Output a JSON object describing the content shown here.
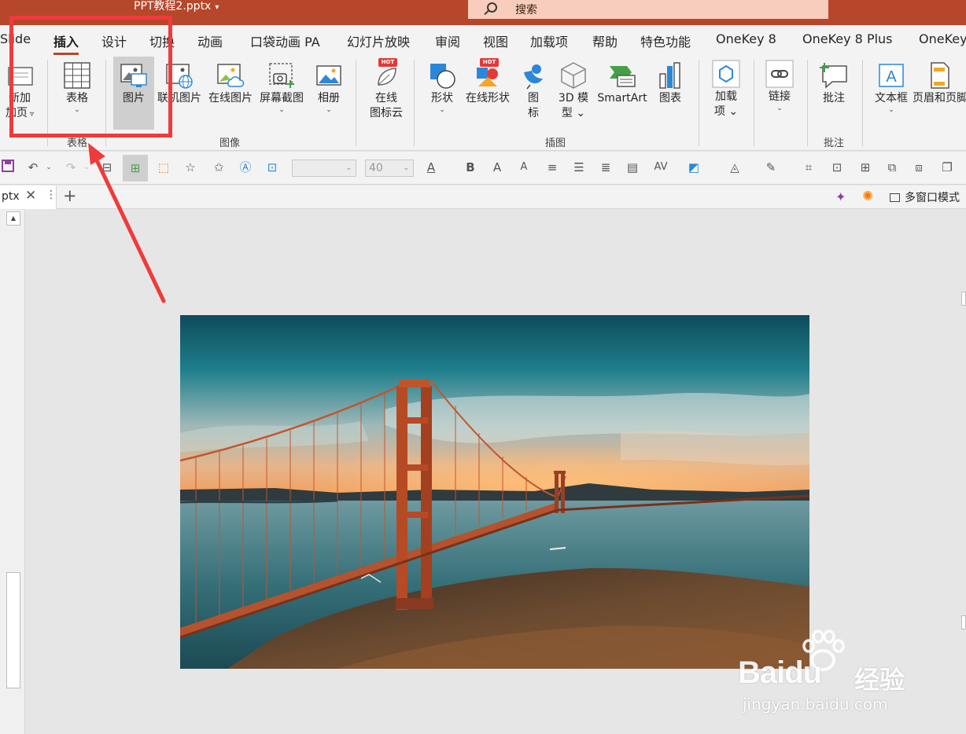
{
  "titlebar": {
    "doc_title": "PPT教程2.pptx",
    "caret": "▾",
    "search_placeholder": "搜索"
  },
  "tabs": [
    {
      "label": "Slide",
      "active": false
    },
    {
      "label": "插入",
      "active": true
    },
    {
      "label": "设计",
      "active": false
    },
    {
      "label": "切换",
      "active": false
    },
    {
      "label": "动画",
      "active": false
    },
    {
      "label": "口袋动画 PA",
      "active": false
    },
    {
      "label": "幻灯片放映",
      "active": false
    },
    {
      "label": "审阅",
      "active": false
    },
    {
      "label": "视图",
      "active": false
    },
    {
      "label": "加载项",
      "active": false
    },
    {
      "label": "帮助",
      "active": false
    },
    {
      "label": "特色功能",
      "active": false
    },
    {
      "label": "OneKey 8",
      "active": false
    },
    {
      "label": "OneKey 8 Plus",
      "active": false
    },
    {
      "label": "OneKey",
      "active": false
    }
  ],
  "ribbon": {
    "new_slide": {
      "line1": "新加",
      "line2": "加页",
      "dropdown": "▿"
    },
    "table": {
      "label": "表格",
      "dropdown": "⌄"
    },
    "picture": {
      "label": "图片"
    },
    "linked_picture": {
      "label": "联机图片"
    },
    "online_picture": {
      "label": "在线图片"
    },
    "screenshot": {
      "label": "屏幕截图",
      "dropdown": "⌄"
    },
    "album": {
      "label": "相册",
      "dropdown": "⌄"
    },
    "icon_cloud": {
      "line1": "在线",
      "line2": "图标云",
      "badge": "HOT"
    },
    "shapes": {
      "label": "形状",
      "dropdown": "⌄"
    },
    "online_shapes": {
      "label": "在线形状",
      "badge": "HOT"
    },
    "icons": {
      "line1": "图",
      "line2": "标"
    },
    "model3d": {
      "line1": "3D 模",
      "line2": "型 ⌄"
    },
    "smartart": {
      "label": "SmartArt"
    },
    "chart": {
      "label": "图表"
    },
    "addins": {
      "line1": "加载",
      "line2": "项 ⌄"
    },
    "link": {
      "label": "链接",
      "dropdown": "⌄"
    },
    "comment": {
      "label": "批注"
    },
    "textbox": {
      "label": "文本框",
      "dropdown": "⌄"
    },
    "header_footer": {
      "label": "页眉和页脚"
    },
    "groups": {
      "tables": "表格",
      "images": "图像",
      "illustrations": "插图",
      "comments": "批注"
    }
  },
  "toolbar": {
    "font_size": "40",
    "font_name": "",
    "font_color_label": "A",
    "bold_label": "B",
    "grow_label": "A",
    "shrink_label": "A",
    "spacing_label": "AV"
  },
  "doc_tabs": {
    "tab_label": "ptx",
    "close": "✕",
    "menu": "⋮",
    "add": "+",
    "multi_window": "多窗口模式"
  },
  "watermark": {
    "logo": "Baidu",
    "cn": "经验",
    "url": "jingyan.baidu.com"
  },
  "colors": {
    "accent": "#b7472a",
    "highlight": "#ef3b3b",
    "ribbon_bg": "#f3f3f3"
  }
}
